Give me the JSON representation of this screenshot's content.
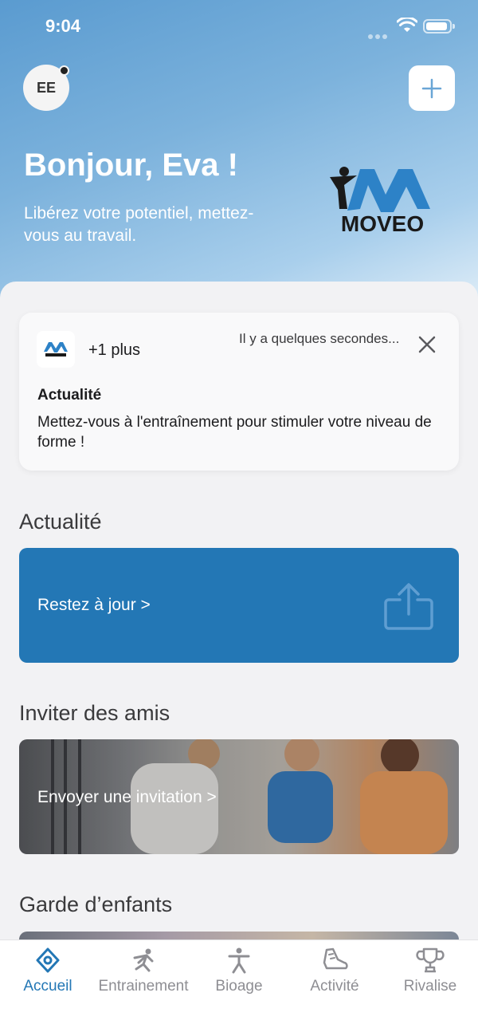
{
  "status_bar": {
    "time": "9:04"
  },
  "header": {
    "avatar_initials": "EE",
    "greeting": "Bonjour, Eva !",
    "subtitle": "Libérez votre potentiel, mettez-vous au travail.",
    "brand_name": "MOVEO"
  },
  "notification": {
    "more": "+1 plus",
    "time": "Il y a quelques secondes...",
    "title": "Actualité",
    "body": "Mettez-vous à l'entraînement pour stimuler votre niveau de forme !"
  },
  "sections": {
    "news_title": "Actualité",
    "news_card_label": "Restez à jour >",
    "invite_title": "Inviter des amis",
    "invite_card_label": "Envoyer une invitation >",
    "childcare_title": "Garde d’enfants"
  },
  "tabs": [
    {
      "label": "Accueil",
      "icon": "home-target-icon",
      "active": true
    },
    {
      "label": "Entrainement",
      "icon": "running-icon",
      "active": false
    },
    {
      "label": "Bioage",
      "icon": "person-icon",
      "active": false
    },
    {
      "label": "Activité",
      "icon": "shoe-icon",
      "active": false
    },
    {
      "label": "Rivalise",
      "icon": "trophy-icon",
      "active": false
    }
  ],
  "colors": {
    "accent": "#2377b5",
    "hero_gradient_start": "#5a9bd0",
    "hero_gradient_end": "#e6f1f9",
    "tab_inactive": "#8e8e93"
  }
}
